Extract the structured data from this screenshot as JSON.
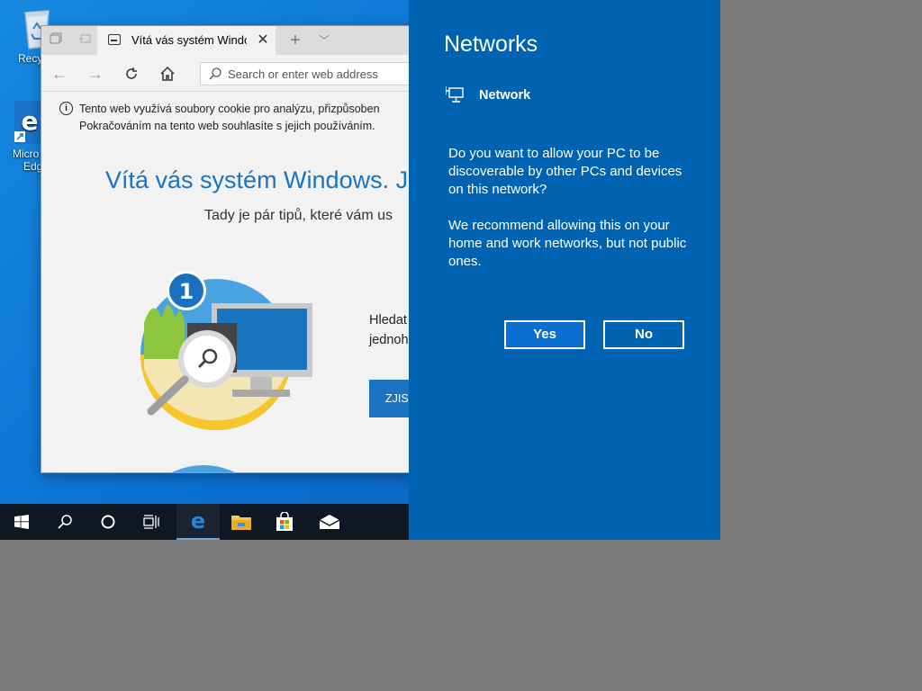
{
  "desktop": {
    "recycle_bin_label": "Recycl",
    "edge_label_line1": "Micro",
    "edge_label_line2": "Edg"
  },
  "browser": {
    "tab_title": "Vítá vás systém Window",
    "address_placeholder": "Search or enter web address",
    "cookie_line1": "Tento web využívá soubory cookie pro analýzu, přizpůsoben",
    "cookie_line2": "Pokračováním na tento web souhlasíte s jejich používáním.",
    "welcome_heading": "Vítá vás systém Windows. Je",
    "tips_text": "Tady je pár tipů, které vám us",
    "step_number": "1",
    "side_text_line1": "Hledat",
    "side_text_line2": "jednoh",
    "cta_label": "ZJIST"
  },
  "taskbar": {
    "items": [
      "start-icon",
      "search-icon",
      "cortana-icon",
      "task-view-icon",
      "edge-icon",
      "file-explorer-icon",
      "store-icon",
      "mail-icon"
    ],
    "active_item": "edge-icon"
  },
  "networks": {
    "title": "Networks",
    "network_name": "Network",
    "question": "Do you want to allow your PC to be discoverable by other PCs and devices on this network?",
    "recommendation": "We recommend allowing this on your home and work networks, but not public ones.",
    "yes_label": "Yes",
    "no_label": "No",
    "accent_color": "#0063b1"
  }
}
